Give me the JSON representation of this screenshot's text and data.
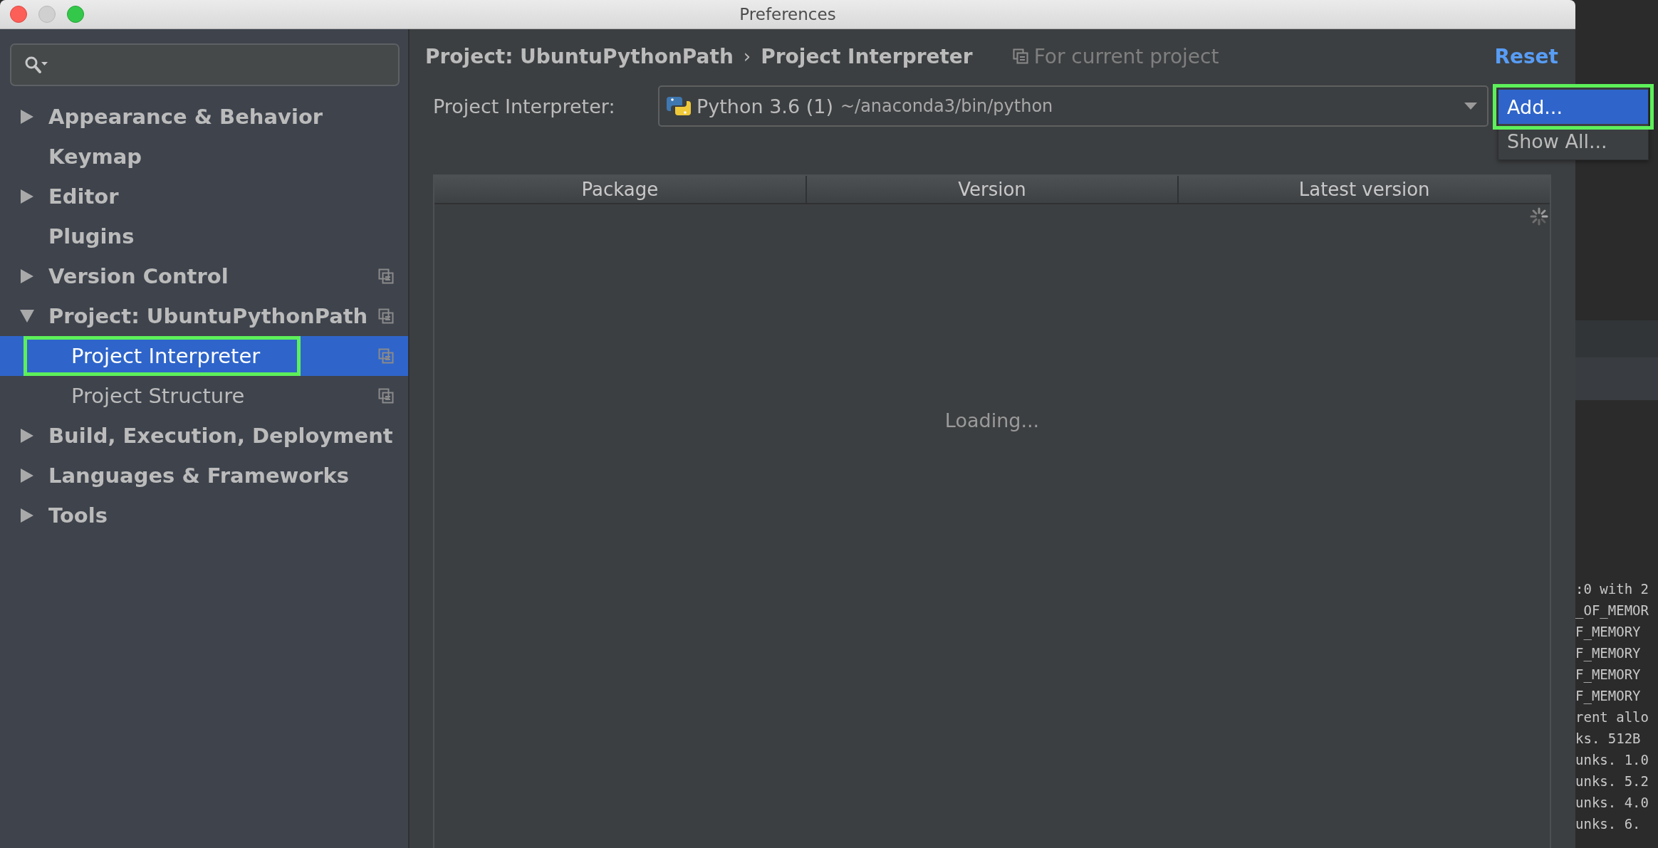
{
  "window": {
    "title": "Preferences"
  },
  "tree": [
    {
      "label": "Appearance & Behavior",
      "expanded": false,
      "selected": false,
      "scoped": false
    },
    {
      "label": "Keymap",
      "selected": false,
      "scoped": false
    },
    {
      "label": "Editor",
      "expanded": false,
      "selected": false,
      "scoped": false
    },
    {
      "label": "Plugins",
      "selected": false,
      "scoped": false
    },
    {
      "label": "Version Control",
      "expanded": false,
      "selected": false,
      "scoped": true
    },
    {
      "label": "Project: UbuntuPythonPath",
      "expanded": true,
      "selected": false,
      "scoped": true,
      "children": [
        {
          "label": "Project Interpreter",
          "selected": true,
          "highlighted": true,
          "scoped": true
        },
        {
          "label": "Project Structure",
          "selected": false,
          "highlighted": false,
          "scoped": true
        }
      ]
    },
    {
      "label": "Build, Execution, Deployment",
      "expanded": false,
      "selected": false,
      "scoped": false
    },
    {
      "label": "Languages & Frameworks",
      "expanded": false,
      "selected": false,
      "scoped": false
    },
    {
      "label": "Tools",
      "expanded": false,
      "selected": false,
      "scoped": false
    }
  ],
  "breadcrumb": {
    "parent": "Project: UbuntuPythonPath",
    "separator": "›",
    "current": "Project Interpreter"
  },
  "scope_note": "For current project",
  "reset_link": "Reset",
  "interpreter": {
    "label": "Project Interpreter:",
    "name": "Python 3.6 (1)",
    "path": "~/anaconda3/bin/python"
  },
  "menu": [
    {
      "label": "Add...",
      "selected": true,
      "highlighted": true
    },
    {
      "label": "Show All...",
      "selected": false,
      "highlighted": false
    }
  ],
  "table": {
    "columns": [
      "Package",
      "Version",
      "Latest version"
    ],
    "status": "Loading..."
  },
  "terminal": {
    "lines": [
      ":0 with 2",
      "_OF_MEMOR",
      "F_MEMORY",
      "F_MEMORY",
      "F_MEMORY",
      "F_MEMORY",
      "rent allo",
      "ks. 512B",
      "unks. 1.0",
      "unks. 5.2",
      "unks. 4.0",
      "unks. 6."
    ]
  }
}
